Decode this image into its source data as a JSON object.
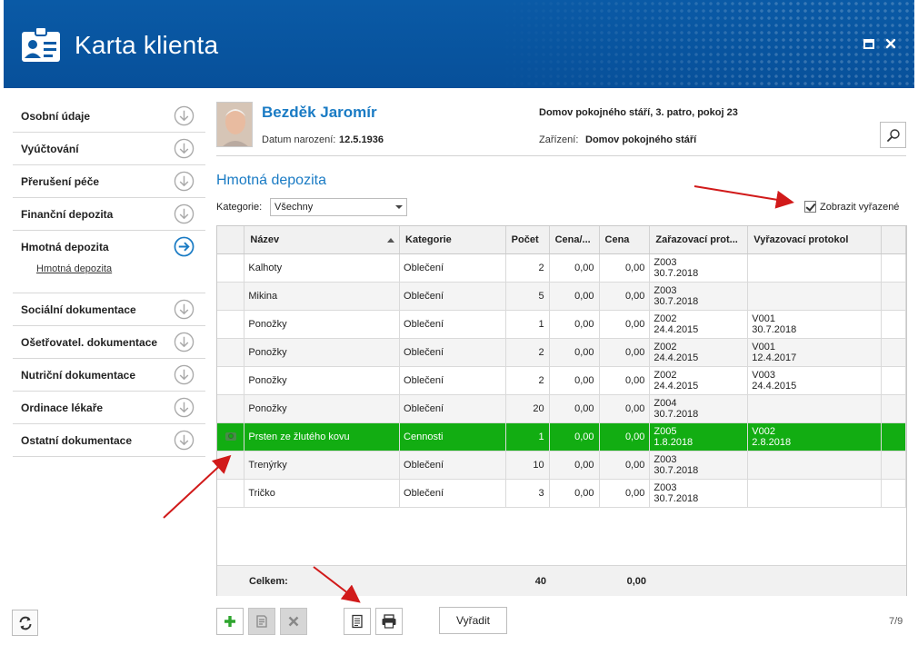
{
  "window": {
    "title": "Karta klienta"
  },
  "sidebar": {
    "items": [
      {
        "label": "Osobní údaje"
      },
      {
        "label": "Vyúčtování"
      },
      {
        "label": "Přerušení péče"
      },
      {
        "label": "Finanční depozita"
      },
      {
        "label": "Hmotná depozita",
        "active": true
      },
      {
        "label": "Sociální dokumentace"
      },
      {
        "label": "Ošetřovatel. dokumentace"
      },
      {
        "label": "Nutriční dokumentace"
      },
      {
        "label": "Ordinace lékaře"
      },
      {
        "label": "Ostatní dokumentace"
      }
    ],
    "subitem": "Hmotná depozita"
  },
  "client": {
    "name": "Bezděk Jaromír",
    "dob_label": "Datum narození:",
    "dob": "12.5.1936",
    "address": "Domov pokojného stáří, 3. patro, pokoj 23",
    "facility_label": "Zařízení:",
    "facility": "Domov pokojného stáří"
  },
  "section": {
    "title": "Hmotná depozita",
    "category_label": "Kategorie:",
    "category_value": "Všechny",
    "show_removed_label": "Zobrazit vyřazené"
  },
  "table": {
    "columns": [
      "Název",
      "Kategorie",
      "Počet",
      "Cena/...",
      "Cena",
      "Zařazovací prot...",
      "Vyřazovací protokol"
    ],
    "rows": [
      {
        "name": "Kalhoty",
        "cat": "Oblečení",
        "count": "2",
        "unit": "0,00",
        "price": "0,00",
        "inc1": "Z003",
        "inc2": "30.7.2018",
        "out1": "",
        "out2": ""
      },
      {
        "name": "Mikina",
        "cat": "Oblečení",
        "count": "5",
        "unit": "0,00",
        "price": "0,00",
        "inc1": "Z003",
        "inc2": "30.7.2018",
        "out1": "",
        "out2": ""
      },
      {
        "name": "Ponožky",
        "cat": "Oblečení",
        "count": "1",
        "unit": "0,00",
        "price": "0,00",
        "inc1": "Z002",
        "inc2": "24.4.2015",
        "out1": "V001",
        "out2": "30.7.2018"
      },
      {
        "name": "Ponožky",
        "cat": "Oblečení",
        "count": "2",
        "unit": "0,00",
        "price": "0,00",
        "inc1": "Z002",
        "inc2": "24.4.2015",
        "out1": "V001",
        "out2": "12.4.2017"
      },
      {
        "name": "Ponožky",
        "cat": "Oblečení",
        "count": "2",
        "unit": "0,00",
        "price": "0,00",
        "inc1": "Z002",
        "inc2": "24.4.2015",
        "out1": "V003",
        "out2": "24.4.2015"
      },
      {
        "name": "Ponožky",
        "cat": "Oblečení",
        "count": "20",
        "unit": "0,00",
        "price": "0,00",
        "inc1": "Z004",
        "inc2": "30.7.2018",
        "out1": "",
        "out2": ""
      },
      {
        "name": "Prsten ze žlutého kovu",
        "cat": "Cennosti",
        "count": "1",
        "unit": "0,00",
        "price": "0,00",
        "inc1": "Z005",
        "inc2": "1.8.2018",
        "out1": "V002",
        "out2": "2.8.2018",
        "selected": true
      },
      {
        "name": "Trenýrky",
        "cat": "Oblečení",
        "count": "10",
        "unit": "0,00",
        "price": "0,00",
        "inc1": "Z003",
        "inc2": "30.7.2018",
        "out1": "",
        "out2": ""
      },
      {
        "name": "Tričko",
        "cat": "Oblečení",
        "count": "3",
        "unit": "0,00",
        "price": "0,00",
        "inc1": "Z003",
        "inc2": "30.7.2018",
        "out1": "",
        "out2": ""
      }
    ],
    "footer": {
      "label": "Celkem:",
      "count": "40",
      "price": "0,00"
    }
  },
  "toolbar": {
    "removed_button": "Vyřadit",
    "pager": "7/9"
  },
  "colors": {
    "header": "#0a5aa6",
    "accent": "#1a7bc4",
    "selected_row": "#12ad12",
    "annotation": "#d11a1a"
  },
  "icons": {
    "header": "client-card-icon",
    "sidebar": "circle-arrow-down-icon",
    "sidebar_active": "circle-arrow-right-icon",
    "search": "search-icon",
    "add": "plus-icon",
    "edit": "edit-icon",
    "delete": "delete-icon",
    "document": "document-icon",
    "print": "print-icon",
    "refresh": "refresh-icon",
    "row": "camera-icon"
  }
}
